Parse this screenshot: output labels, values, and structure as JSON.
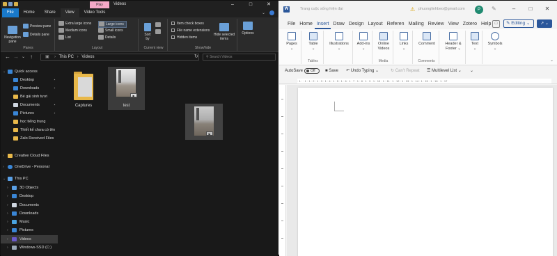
{
  "explorer": {
    "title": "Videos",
    "context_tab": "Play",
    "tabs": [
      "File",
      "Home",
      "Share",
      "View",
      "Video Tools"
    ],
    "ribbon": {
      "panes": {
        "navigation_pane": "Navigation pane",
        "preview_pane": "Preview pane",
        "details_pane": "Details pane",
        "label": "Panes"
      },
      "layout": {
        "items": [
          "Extra large icons",
          "Large icons",
          "Medium icons",
          "Small icons",
          "List",
          "Details"
        ],
        "selected": "Large icons",
        "label": "Layout"
      },
      "current_view": {
        "sort_by": "Sort by",
        "label": "Current view"
      },
      "show_hide": {
        "checkboxes": [
          "Item check boxes",
          "File name extensions",
          "Hidden items"
        ],
        "hide_selected": "Hide selected items",
        "label": "Show/hide"
      },
      "options": "Options"
    },
    "address": {
      "parts": [
        "This PC",
        "Videos"
      ],
      "search_placeholder": "Search Videos"
    },
    "nav": {
      "quick_access": "Quick access",
      "quick_items": [
        "Desktop",
        "Downloads",
        "Bé gái xinh tươi",
        "Documents",
        "Pictures",
        "học tiếng trung",
        "Thiết kế chưa có tên",
        "Zalo Received Files"
      ],
      "creative_cloud": "Creative Cloud Files",
      "onedrive": "OneDrive - Personal",
      "this_pc": "This PC",
      "pc_items": [
        "3D Objects",
        "Desktop",
        "Documents",
        "Downloads",
        "Music",
        "Pictures",
        "Videos",
        "Windows-SSD (C:)"
      ]
    },
    "files": [
      {
        "name": "Captures",
        "type": "folder"
      },
      {
        "name": "test",
        "type": "video"
      },
      {
        "name": "",
        "type": "video-drag"
      }
    ]
  },
  "word": {
    "doc_title": "Trang cuộc sống hiện đại",
    "email": "phuonglinhbeo@gmail.com",
    "avatar": "P",
    "tabs": [
      "File",
      "Home",
      "Insert",
      "Draw",
      "Design",
      "Layout",
      "Referen",
      "Mailing",
      "Review",
      "View",
      "Zotero",
      "Help"
    ],
    "active_tab": "Insert",
    "editing": "Editing",
    "ribbon": [
      {
        "label": "Pages",
        "group": ""
      },
      {
        "label": "Table",
        "group": "Tables"
      },
      {
        "label": "Illustrations",
        "group": ""
      },
      {
        "label": "Add-ins",
        "group": ""
      },
      {
        "label": "Online Videos",
        "group": "Media"
      },
      {
        "label": "Links",
        "group": ""
      },
      {
        "label": "Comment",
        "group": "Comments"
      },
      {
        "label": "Header & Footer",
        "group": ""
      },
      {
        "label": "Text",
        "group": ""
      },
      {
        "label": "Symbols",
        "group": ""
      }
    ],
    "qat": {
      "autosave": "AutoSave",
      "autosave_state": "Off",
      "save": "Save",
      "undo": "Undo Typing",
      "repeat": "Can't Repeat",
      "multilevel": "Multilevel List"
    },
    "colors": {
      "accent": "#2b579a"
    }
  }
}
